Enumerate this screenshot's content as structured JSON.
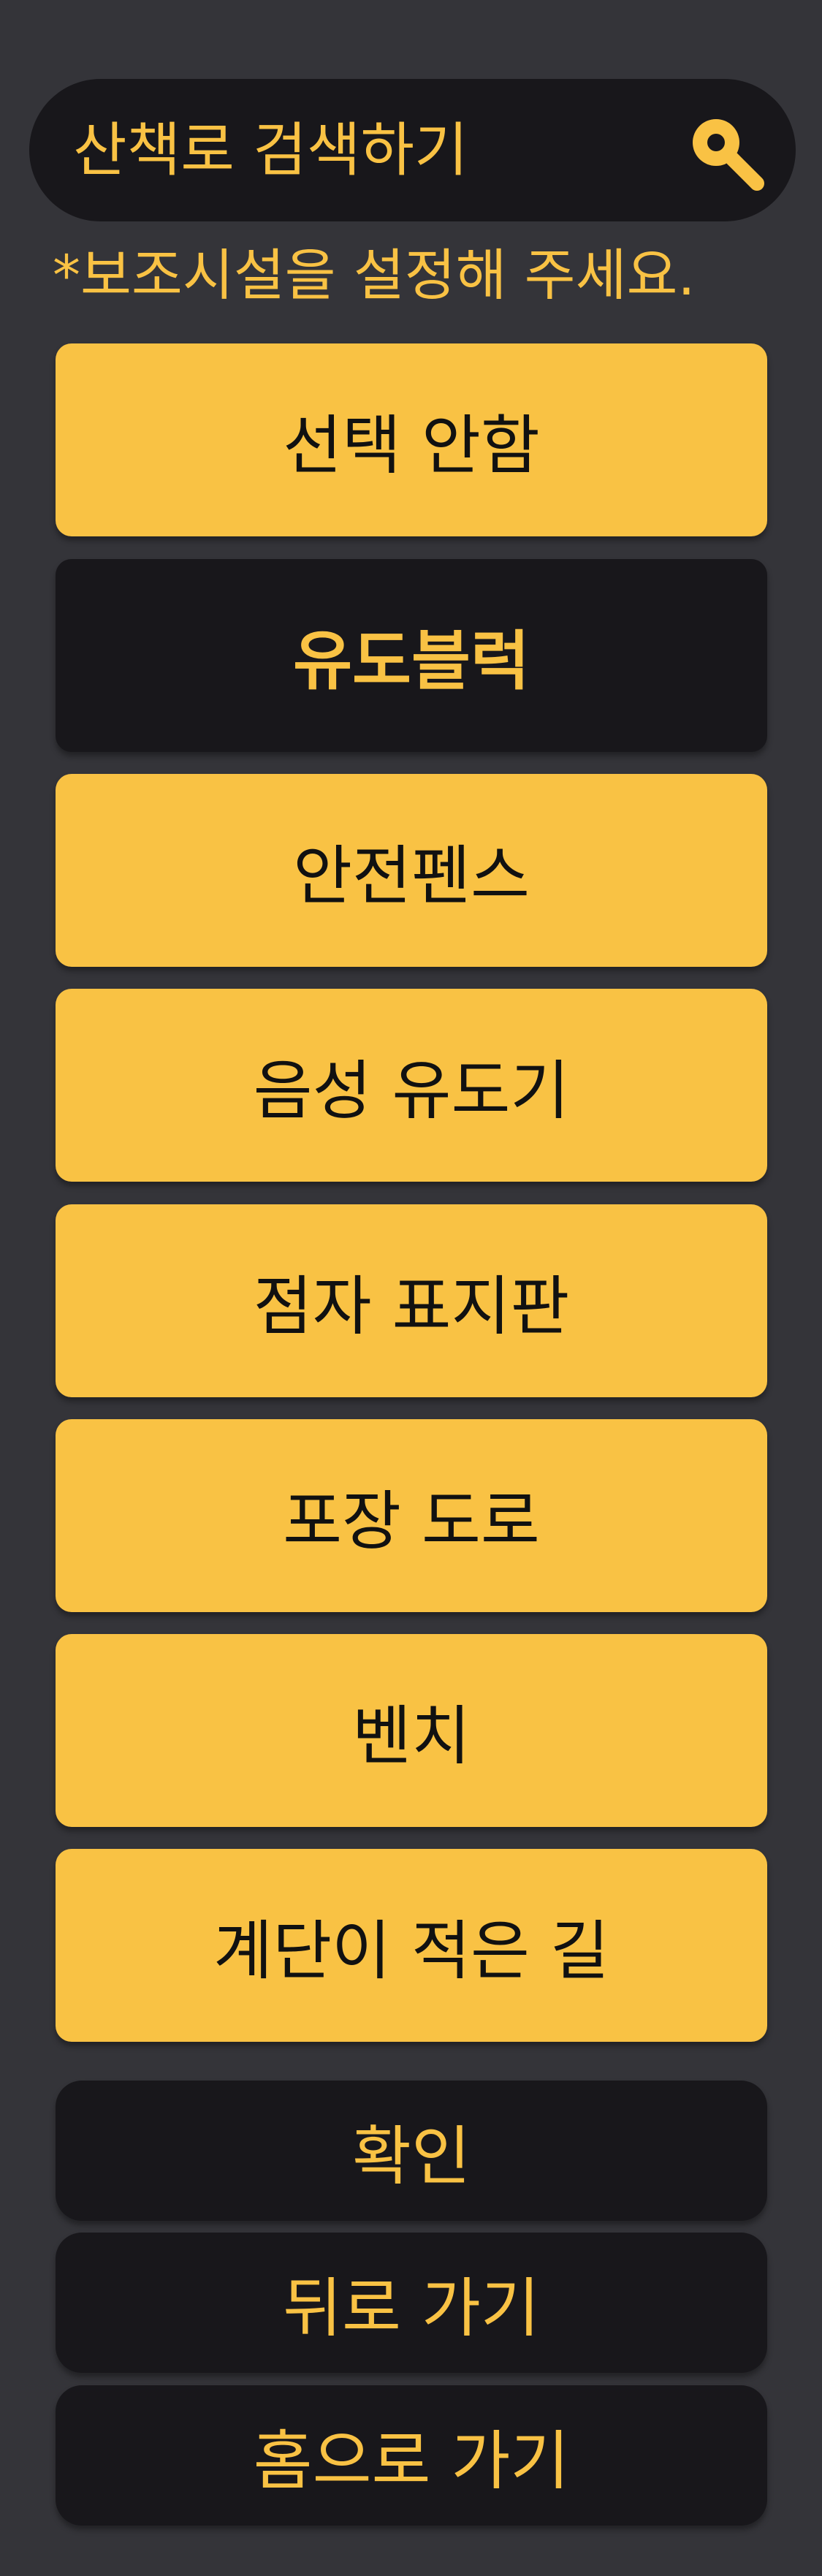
{
  "search": {
    "text": "산책로 검색하기",
    "icon": "search-icon"
  },
  "hint": "*보조시설을 설정해 주세요.",
  "options": [
    {
      "label": "선택 안함"
    },
    {
      "label": "유도블럭"
    },
    {
      "label": "안전펜스"
    },
    {
      "label": "음성 유도기"
    },
    {
      "label": "점자 표지판"
    },
    {
      "label": "포장 도로"
    },
    {
      "label": "벤치"
    },
    {
      "label": "계단이 적은 길"
    }
  ],
  "selected_option": "유도블럭",
  "actions": {
    "confirm": "확인",
    "back": "뒤로 가기",
    "home": "홈으로 가기"
  },
  "colors": {
    "background": "#343439",
    "accent": "#F9C244",
    "dark": "#18171B",
    "text_dark": "#111111"
  }
}
